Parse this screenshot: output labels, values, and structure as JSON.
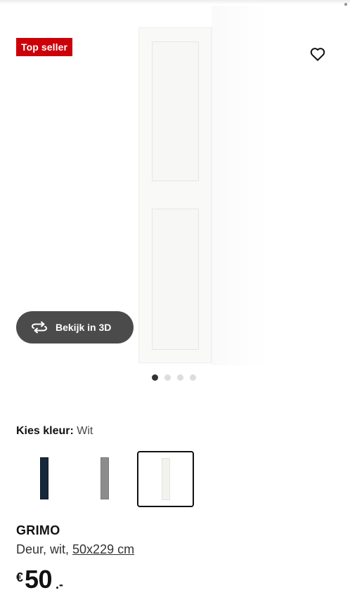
{
  "product_image": {
    "badge": "Top seller",
    "favorite_icon": "heart-icon",
    "view_3d": {
      "label": "Bekijk in 3D",
      "icon": "rotate-3d-icon"
    },
    "carousel": {
      "total": 4,
      "active_index": 0
    }
  },
  "colour_picker": {
    "label": "Kies kleur:",
    "selected_value": "Wit",
    "swatches": [
      {
        "name": "dark-blue",
        "color": "#17283a"
      },
      {
        "name": "grey",
        "color": "#8c8c8c"
      },
      {
        "name": "white",
        "color": "#f2f2ef",
        "selected": true
      }
    ]
  },
  "product": {
    "name": "GRIMO",
    "description": "Deur, wit, ",
    "size_link": "50x229 cm",
    "price": {
      "currency": "€",
      "integer": "50",
      "decimal": ".-"
    }
  },
  "colors": {
    "badge": "#cc0008",
    "button_3d": "#4b4b4b"
  }
}
